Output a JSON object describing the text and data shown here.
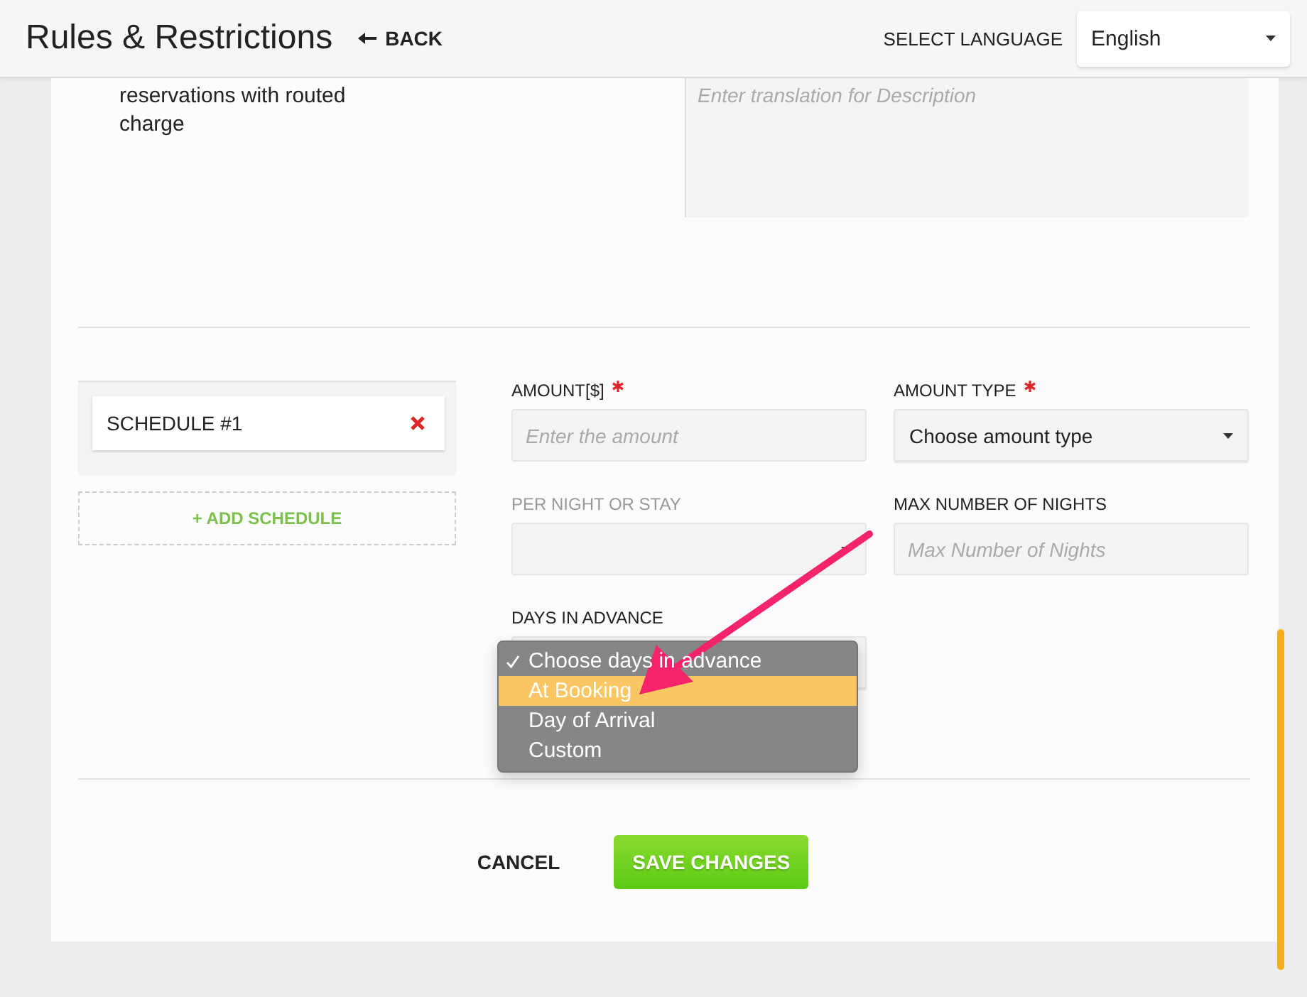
{
  "header": {
    "title": "Rules & Restrictions",
    "back": "BACK",
    "language_label": "SELECT LANGUAGE",
    "language": "English"
  },
  "description": {
    "text": "reservations with routed charge",
    "translation_placeholder": "Enter translation for Description"
  },
  "schedules": [
    {
      "label": "SCHEDULE #1"
    }
  ],
  "add_schedule": "+ ADD SCHEDULE",
  "fields": [
    {
      "kind": "input",
      "label": "AMOUNT[$]",
      "required": true,
      "placeholder": "Enter the amount",
      "disabled": false
    },
    {
      "kind": "select",
      "label": "AMOUNT TYPE",
      "required": true,
      "value": "Choose amount type",
      "disabled": false
    },
    {
      "kind": "select",
      "label": "PER NIGHT OR STAY",
      "required": false,
      "disabled": true
    },
    {
      "kind": "input",
      "label": "MAX NUMBER OF NIGHTS",
      "required": false,
      "placeholder": "Max Number of Nights",
      "disabled": false
    },
    {
      "kind": "open_select",
      "label": "DAYS IN ADVANCE",
      "required": false,
      "disabled": false,
      "options": [
        {
          "label": "Choose days in advance",
          "checked": true,
          "selected": false
        },
        {
          "label": "At Booking",
          "checked": false,
          "selected": true
        },
        {
          "label": "Day of Arrival",
          "checked": false,
          "selected": false
        },
        {
          "label": "Custom",
          "checked": false,
          "selected": false
        }
      ]
    }
  ],
  "buttons": {
    "cancel": "CANCEL",
    "save": "SAVE CHANGES"
  }
}
